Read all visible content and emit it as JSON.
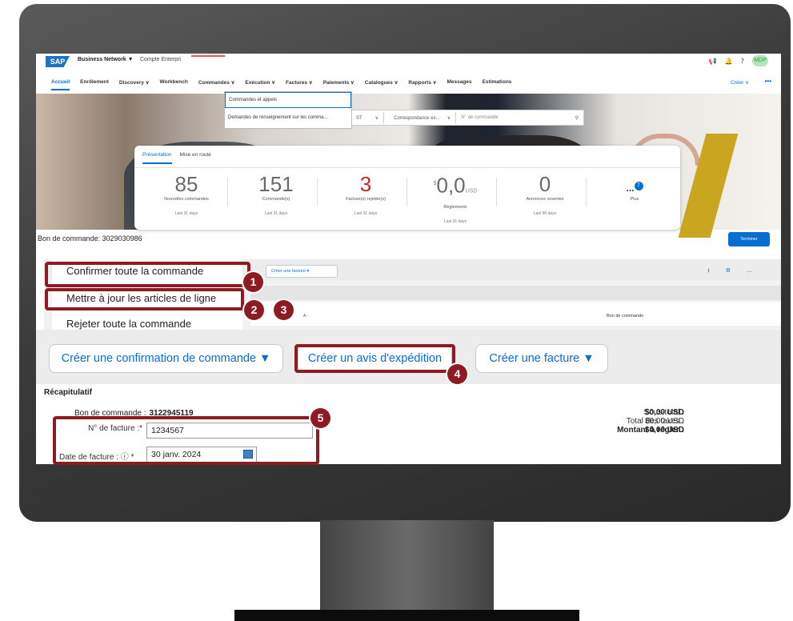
{
  "topbar": {
    "logo": "SAP",
    "product": "Business Network ▼",
    "account": "Compte Enterpri",
    "icons": [
      "megaphone-icon",
      "bell-icon",
      "help-icon"
    ],
    "avatar": "MDP",
    "create": "Créer ∨",
    "more": "•••"
  },
  "nav": {
    "items": [
      "Accueil",
      "Enrôlement",
      "Discovery ∨",
      "Workbench",
      "Commandes ∨",
      "Exécution ∨",
      "Factures ∨",
      "Paiements ∨",
      "Catalogues ∨",
      "Rapports ∨",
      "Messages",
      "Estimations"
    ]
  },
  "dropdown": {
    "item1": "Commandes et appels",
    "item2": "Demandes de renseignement sur les comma..."
  },
  "search": {
    "st": "ST",
    "corr": "Correspondance ex...",
    "placeholder": "N° de commande"
  },
  "overview": {
    "tabs": [
      "Présentation",
      "Mise en route"
    ],
    "tiles": [
      {
        "value": "85",
        "label": "Nouvelles commandes",
        "period": "Last 31 days"
      },
      {
        "value": "151",
        "label": "Commande(s)",
        "period": "Last 31 days"
      },
      {
        "value": "3",
        "label": "Facture(s) rejetée(s)",
        "period": "Last 31 days"
      },
      {
        "value": "0,0",
        "prefix": "$",
        "unit": "USD",
        "label": "Règlements",
        "period": "Last 31 days"
      },
      {
        "value": "0",
        "label": "Annonces ouvertes",
        "period": "Last 90 days"
      },
      {
        "value": "...",
        "badge": "7",
        "label": "Plus"
      }
    ]
  },
  "po": {
    "title": "Bon de commande: 3029030986",
    "finish": "Terminer",
    "create_invoice_small": "Créer une facture ▾",
    "col_a": "A -",
    "col_bdc": "Bon de commande",
    "panel_icons": [
      "download-icon",
      "settings-icon",
      "more-icon"
    ]
  },
  "menu": {
    "confirm_all": "Confirmer toute la commande",
    "update_lines": "Mettre à jour les articles de ligne",
    "reject_all": "Rejeter toute la commande"
  },
  "actions": {
    "create_confirmation": "Créer une confirmation de commande ▼",
    "create_asn": "Créer un avis d'expédition",
    "create_invoice": "Créer une facture ▼"
  },
  "recap": {
    "title": "Récapitulatif",
    "po_label": "Bon de commande :",
    "po_value": "3122945119",
    "invoice_label": "N° de facture :*",
    "invoice_value": "1234567",
    "date_label": "Date de facture : ⓘ *",
    "date_value": "30 janv. 2024",
    "totals_labels": [
      "Sous-total :",
      "Total des taxes :",
      "Montant à régler :"
    ],
    "totals_values": [
      "$0,00 USD",
      "$0,00 USD",
      "$0,00 USD"
    ]
  },
  "badges": [
    "1",
    "2",
    "3",
    "4",
    "5"
  ],
  "colors": {
    "accent": "#0a6ed1",
    "highlight": "#8e1b22",
    "error": "#c62828"
  }
}
